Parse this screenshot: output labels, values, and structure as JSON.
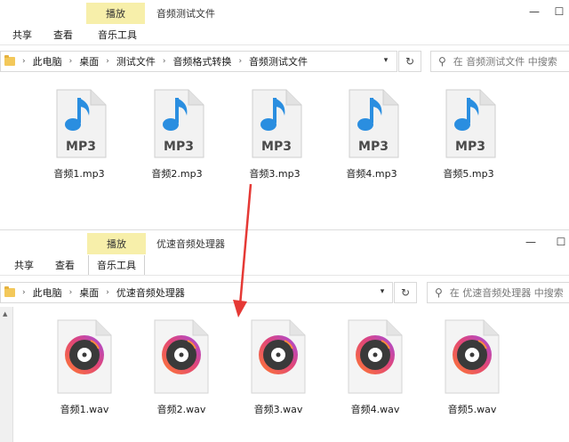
{
  "top_window": {
    "context_tab": "播放",
    "title": "音频测试文件",
    "ribbon_tabs": [
      "共享",
      "查看",
      "音乐工具"
    ],
    "breadcrumb": [
      "此电脑",
      "桌面",
      "测试文件",
      "音频格式转换",
      "音频测试文件"
    ],
    "search_placeholder": "在 音频测试文件 中搜索",
    "file_badge": "MP3",
    "files": [
      {
        "name": "音频1.mp3"
      },
      {
        "name": "音频2.mp3"
      },
      {
        "name": "音频3.mp3"
      },
      {
        "name": "音频4.mp3"
      },
      {
        "name": "音频5.mp3"
      }
    ]
  },
  "bottom_window": {
    "context_tab": "播放",
    "title": "优速音频处理器",
    "ribbon_tabs": [
      "共享",
      "查看",
      "音乐工具"
    ],
    "breadcrumb": [
      "此电脑",
      "桌面",
      "优速音频处理器"
    ],
    "search_placeholder": "在 优速音频处理器 中搜索",
    "files": [
      {
        "name": "音频1.wav"
      },
      {
        "name": "音频2.wav"
      },
      {
        "name": "音频3.wav"
      },
      {
        "name": "音频4.wav"
      },
      {
        "name": "音频5.wav"
      }
    ]
  },
  "colors": {
    "context_tab_bg": "#f7efaa",
    "arrow": "#e53935",
    "music_note": "#2a8ee0",
    "mp3_label": "#4a4a4a",
    "disc_gradient_start": "#ff8a3d",
    "disc_gradient_end": "#b14bd8"
  },
  "icons": {
    "folder": "folder-icon",
    "search": "search-icon",
    "refresh": "refresh-icon",
    "mp3": "mp3-file-icon",
    "wav": "vinyl-disc-file-icon"
  }
}
